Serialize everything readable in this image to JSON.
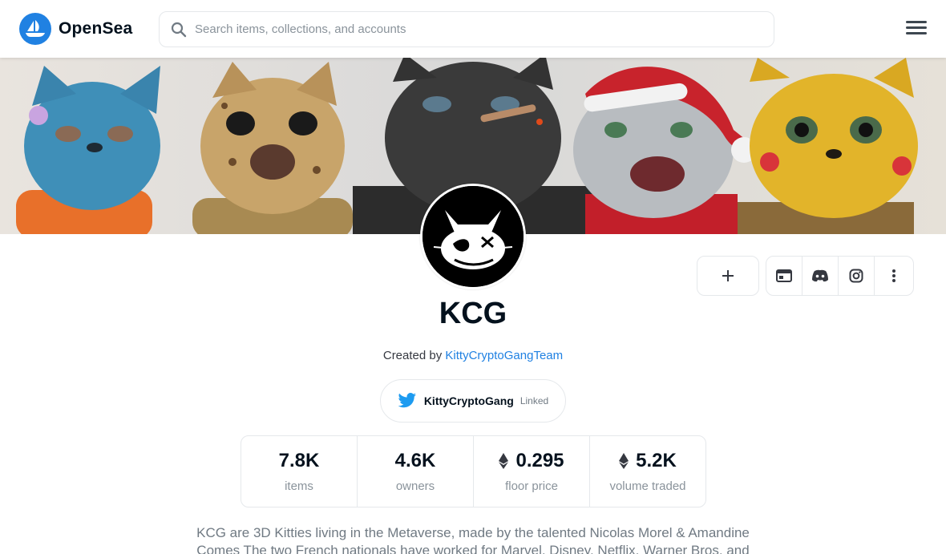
{
  "header": {
    "brand": "OpenSea",
    "search_placeholder": "Search items, collections, and accounts",
    "brand_color": "#2081e2"
  },
  "collection": {
    "name": "KCG",
    "created_by_prefix": "Created by",
    "creator": "KittyCryptoGangTeam",
    "twitter_handle": "KittyCryptoGang",
    "twitter_status": "Linked",
    "description": "KCG are 3D Kitties living in the Metaverse, made by the talented Nicolas Morel & Amandine Comes The two French nationals have worked for Marvel, Disney, Netflix, Warner Bros, and"
  },
  "stats": [
    {
      "value": "7.8K",
      "label": "items",
      "eth": false
    },
    {
      "value": "4.6K",
      "label": "owners",
      "eth": false
    },
    {
      "value": "0.295",
      "label": "floor price",
      "eth": true
    },
    {
      "value": "5.2K",
      "label": "volume traded",
      "eth": true
    }
  ],
  "icons": {
    "add": "plus-icon",
    "website": "website-icon",
    "discord": "discord-icon",
    "instagram": "instagram-icon",
    "more": "more-vertical-icon",
    "twitter": "twitter-icon",
    "search": "search-icon",
    "menu": "hamburger-menu-icon"
  }
}
